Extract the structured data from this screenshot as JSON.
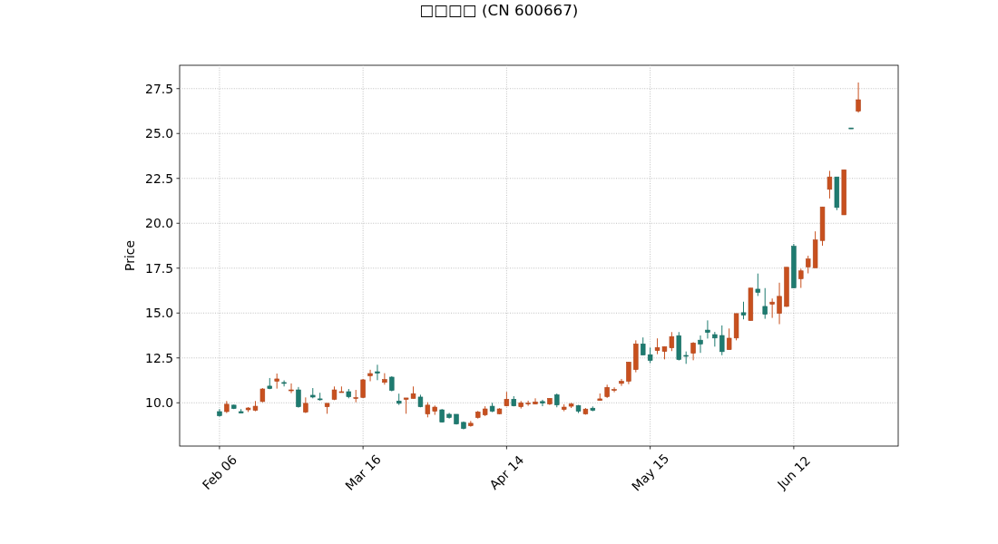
{
  "chart": {
    "chart_data": {
      "type": "candlestick",
      "title": "□□□□ (CN 600667)",
      "ylabel": "Price",
      "grid": true,
      "ylim": [
        7.59,
        28.8
      ],
      "yticks": [
        {
          "value": 10,
          "label": "10.0"
        },
        {
          "value": 12.5,
          "label": "12.5"
        },
        {
          "value": 15,
          "label": "15.0"
        },
        {
          "value": 17.5,
          "label": "17.5"
        },
        {
          "value": 20,
          "label": "20.0"
        },
        {
          "value": 22.5,
          "label": "22.5"
        },
        {
          "value": 25,
          "label": "25.0"
        },
        {
          "value": 27.5,
          "label": "27.5"
        }
      ],
      "categories": [
        "Feb 06",
        null,
        null,
        null,
        null,
        null,
        null,
        null,
        null,
        null,
        null,
        null,
        null,
        null,
        null,
        null,
        null,
        null,
        null,
        null,
        "Mar 16",
        null,
        null,
        null,
        null,
        null,
        null,
        null,
        null,
        null,
        null,
        null,
        null,
        null,
        null,
        null,
        null,
        null,
        null,
        null,
        "Apr 14",
        null,
        null,
        null,
        null,
        null,
        null,
        null,
        null,
        null,
        null,
        null,
        null,
        null,
        null,
        null,
        null,
        null,
        null,
        null,
        "May 15",
        null,
        null,
        null,
        null,
        null,
        null,
        null,
        null,
        null,
        null,
        null,
        null,
        null,
        null,
        null,
        null,
        null,
        null,
        null,
        "Jun 12",
        null,
        null,
        null,
        null,
        null,
        null,
        null,
        null,
        null
      ],
      "ohlc": [
        [
          9.51,
          9.65,
          9.23,
          9.28
        ],
        [
          9.51,
          10.1,
          9.43,
          9.92
        ],
        [
          9.87,
          9.9,
          9.65,
          9.68
        ],
        [
          9.51,
          9.65,
          9.43,
          9.43
        ],
        [
          9.61,
          9.76,
          9.49,
          9.71
        ],
        [
          9.58,
          10.1,
          9.53,
          9.81
        ],
        [
          10.07,
          10.82,
          10.03,
          10.77
        ],
        [
          10.93,
          11.38,
          10.76,
          10.79
        ],
        [
          11.2,
          11.63,
          10.79,
          11.33
        ],
        [
          11.13,
          11.25,
          10.91,
          11.08
        ],
        [
          10.69,
          11.08,
          10.54,
          10.72
        ],
        [
          10.72,
          10.88,
          9.73,
          9.78
        ],
        [
          9.48,
          10.3,
          9.43,
          9.97
        ],
        [
          10.42,
          10.82,
          10.25,
          10.32
        ],
        [
          10.22,
          10.56,
          10.12,
          10.19
        ],
        [
          9.78,
          9.97,
          9.39,
          9.97
        ],
        [
          10.19,
          10.91,
          10.15,
          10.72
        ],
        [
          10.59,
          10.91,
          10.59,
          10.62
        ],
        [
          10.62,
          10.77,
          10.25,
          10.34
        ],
        [
          10.25,
          10.72,
          10.03,
          10.29
        ],
        [
          10.3,
          11.33,
          10.27,
          11.28
        ],
        [
          11.5,
          11.84,
          11.2,
          11.63
        ],
        [
          11.73,
          12.12,
          11.26,
          11.65
        ],
        [
          11.14,
          11.65,
          11.01,
          11.3
        ],
        [
          11.43,
          11.48,
          10.64,
          10.69
        ],
        [
          10.1,
          10.51,
          9.88,
          9.97
        ],
        [
          10.19,
          10.27,
          9.39,
          10.27
        ],
        [
          10.24,
          10.91,
          10.24,
          10.51
        ],
        [
          10.32,
          10.45,
          9.75,
          9.78
        ],
        [
          9.38,
          10.03,
          9.19,
          9.87
        ],
        [
          9.53,
          9.85,
          9.33,
          9.76
        ],
        [
          9.61,
          9.65,
          8.92,
          8.92
        ],
        [
          9.36,
          9.44,
          9.12,
          9.18
        ],
        [
          9.36,
          9.36,
          8.79,
          8.82
        ],
        [
          8.91,
          8.96,
          8.52,
          8.57
        ],
        [
          8.72,
          8.99,
          8.67,
          8.86
        ],
        [
          9.18,
          9.55,
          9.12,
          9.49
        ],
        [
          9.33,
          9.81,
          9.26,
          9.66
        ],
        [
          9.81,
          10.0,
          9.48,
          9.53
        ],
        [
          9.39,
          9.7,
          9.36,
          9.66
        ],
        [
          9.83,
          10.61,
          9.8,
          10.2
        ],
        [
          10.2,
          10.37,
          9.8,
          9.83
        ],
        [
          9.78,
          10.1,
          9.68,
          10.0
        ],
        [
          9.93,
          10.12,
          9.83,
          9.98
        ],
        [
          9.93,
          10.25,
          9.92,
          10.05
        ],
        [
          10.07,
          10.17,
          9.81,
          9.98
        ],
        [
          9.93,
          10.25,
          9.88,
          10.25
        ],
        [
          10.45,
          10.52,
          9.75,
          9.88
        ],
        [
          9.63,
          9.92,
          9.53,
          9.76
        ],
        [
          9.81,
          10.0,
          9.71,
          9.93
        ],
        [
          9.85,
          9.88,
          9.43,
          9.53
        ],
        [
          9.38,
          9.71,
          9.34,
          9.65
        ],
        [
          9.7,
          9.8,
          9.53,
          9.58
        ],
        [
          10.13,
          10.52,
          10.13,
          10.22
        ],
        [
          10.34,
          11.01,
          10.27,
          10.86
        ],
        [
          10.69,
          10.86,
          10.59,
          10.74
        ],
        [
          11.08,
          11.33,
          10.94,
          11.2
        ],
        [
          11.2,
          12.27,
          11.04,
          12.27
        ],
        [
          11.85,
          13.48,
          11.7,
          13.28
        ],
        [
          13.28,
          13.64,
          12.66,
          12.66
        ],
        [
          12.68,
          13.08,
          12.21,
          12.36
        ],
        [
          12.91,
          13.59,
          12.71,
          13.08
        ],
        [
          12.86,
          13.13,
          12.42,
          13.13
        ],
        [
          13.06,
          13.94,
          12.88,
          13.69
        ],
        [
          13.74,
          13.94,
          12.36,
          12.41
        ],
        [
          12.64,
          12.86,
          12.17,
          12.61
        ],
        [
          12.76,
          13.38,
          12.37,
          13.33
        ],
        [
          13.49,
          13.75,
          12.78,
          13.27
        ],
        [
          14.05,
          14.59,
          13.58,
          13.92
        ],
        [
          13.8,
          13.95,
          13.13,
          13.61
        ],
        [
          13.75,
          14.31,
          12.65,
          12.85
        ],
        [
          12.96,
          14.14,
          12.96,
          13.6
        ],
        [
          13.61,
          14.97,
          13.48,
          14.97
        ],
        [
          15.02,
          15.63,
          14.65,
          14.88
        ],
        [
          14.58,
          16.39,
          14.58,
          16.39
        ],
        [
          16.33,
          17.2,
          15.95,
          16.15
        ],
        [
          15.37,
          16.39,
          14.68,
          14.93
        ],
        [
          15.49,
          15.81,
          14.73,
          15.61
        ],
        [
          14.98,
          16.69,
          14.38,
          15.93
        ],
        [
          15.37,
          17.55,
          15.34,
          17.55
        ],
        [
          18.72,
          18.85,
          16.4,
          16.4
        ],
        [
          16.91,
          17.47,
          16.4,
          17.35
        ],
        [
          17.57,
          18.19,
          17.21,
          18.01
        ],
        [
          17.52,
          19.55,
          17.52,
          19.07
        ],
        [
          19.04,
          20.91,
          18.75,
          20.91
        ],
        [
          21.89,
          22.92,
          21.38,
          22.58
        ],
        [
          22.58,
          22.58,
          20.73,
          20.88
        ],
        [
          20.47,
          22.98,
          20.47,
          22.98
        ],
        [
          25.31,
          25.31,
          25.29,
          25.29
        ],
        [
          26.24,
          27.84,
          26.16,
          26.88
        ]
      ]
    }
  }
}
